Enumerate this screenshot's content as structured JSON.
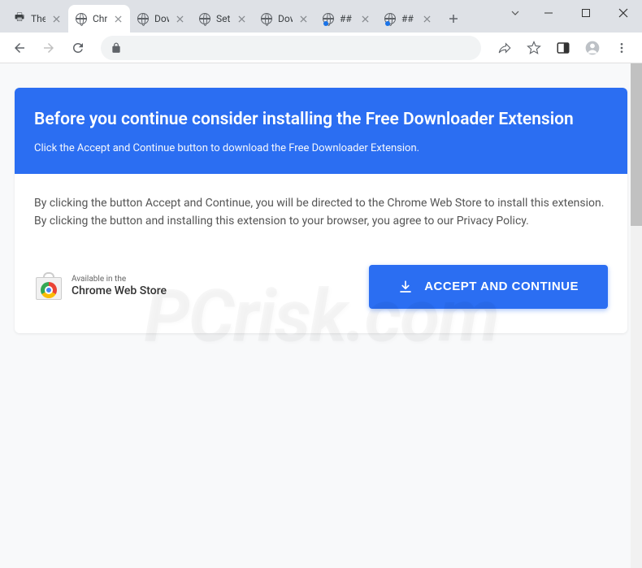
{
  "window": {
    "tabs": [
      {
        "label": "The P",
        "favicon": "printer",
        "active": false,
        "notification": false
      },
      {
        "label": "Chro",
        "favicon": "globe",
        "active": true,
        "notification": false
      },
      {
        "label": "Dow",
        "favicon": "globe",
        "active": false,
        "notification": false
      },
      {
        "label": "Setu",
        "favicon": "globe",
        "active": false,
        "notification": false
      },
      {
        "label": "Dow",
        "favicon": "globe",
        "active": false,
        "notification": false
      },
      {
        "label": "## P",
        "favicon": "globe",
        "active": false,
        "notification": true
      },
      {
        "label": "## P",
        "favicon": "globe",
        "active": false,
        "notification": true
      }
    ]
  },
  "toolbar": {
    "icons": {
      "share": "share-icon",
      "bookmark": "star-icon",
      "extensions": "puzzle-icon",
      "profile": "profile-icon",
      "menu": "menu-icon"
    }
  },
  "page": {
    "header_title": "Before you continue consider installing the Free Downloader Extension",
    "header_subtitle": "Click the Accept and Continue button to download the Free Downloader Extension.",
    "body_text": "By clicking the button Accept and Continue, you will be directed to the Chrome Web Store to install this extension. By clicking the button and installing this extension to your browser, you agree to our Privacy Policy.",
    "webstore_available": "Available in the",
    "webstore_name": "Chrome Web Store",
    "accept_button": "ACCEPT AND CONTINUE"
  },
  "colors": {
    "accent": "#2b6ef2",
    "tab_bg": "#dee1e6"
  },
  "watermark": "PCrisk.com"
}
